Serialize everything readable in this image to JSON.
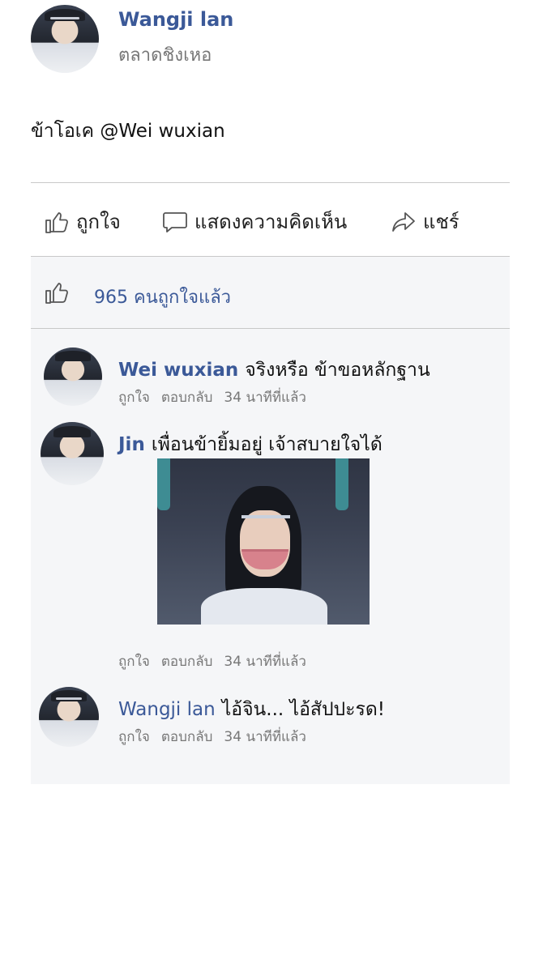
{
  "post": {
    "author": "Wangji lan",
    "subtitle": "ตลาดชิงเหอ",
    "text": "ข้าโอเค @Wei wuxian"
  },
  "actions": {
    "like_label": "ถูกใจ",
    "comment_label": "แสดงความคิดเห็น",
    "share_label": "แชร์"
  },
  "likes": {
    "summary": "965 คนถูกใจแล้ว"
  },
  "comments": [
    {
      "author": "Wei wuxian",
      "text": "จริงหรือ ข้าขอหลักฐาน",
      "like": "ถูกใจ",
      "reply": "ตอบกลับ",
      "time": "34 นาทีที่แล้ว"
    },
    {
      "author": "Jin",
      "text": "เพื่อนข้ายิ้มอยู่ เจ้าสบายใจได้",
      "like": "ถูกใจ",
      "reply": "ตอบกลับ",
      "time": "34 นาทีที่แล้ว"
    },
    {
      "author": "Wangji lan",
      "text": "ไอ้จิน... ไอ้สัปปะรด!",
      "like": "ถูกใจ",
      "reply": "ตอบกลับ",
      "time": "34 นาทีที่แล้ว"
    }
  ],
  "colors": {
    "link_blue": "#3b5998",
    "comments_bg": "#f5f6f8"
  },
  "icons": [
    "thumbs-up-icon",
    "comment-bubble-icon",
    "share-arrow-icon"
  ]
}
